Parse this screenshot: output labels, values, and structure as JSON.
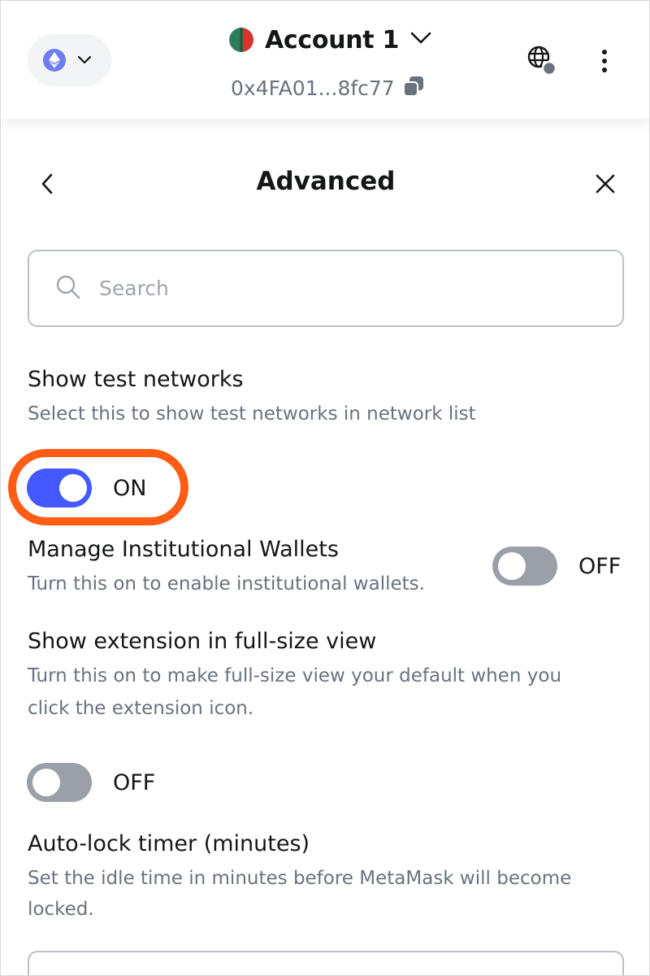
{
  "header": {
    "network_icon": "ethereum-icon",
    "account_name": "Account 1",
    "account_address": "0x4FA01...8fc77",
    "colors": {
      "network_bg": "#f2f4f6",
      "eth": "#6e7bf2"
    }
  },
  "page": {
    "title": "Advanced",
    "back_icon": "chevron-left-icon",
    "close_icon": "close-icon"
  },
  "search": {
    "placeholder": "Search",
    "value": ""
  },
  "settings": [
    {
      "title": "Show test networks",
      "description": "Select this to show test networks in network list",
      "toggle_state": "ON"
    },
    {
      "title": "Manage Institutional Wallets",
      "description": "Turn this on to enable institutional wallets.",
      "toggle_state": "OFF"
    },
    {
      "title": "Show extension in full-size view",
      "description_line1": "Turn this on to make full-size view your default when you",
      "description_line2": "click the extension icon.",
      "toggle_state": "OFF"
    },
    {
      "title": "Auto-lock timer (minutes)",
      "description_line1": "Set the idle time in minutes before MetaMask will become",
      "description_line2": "locked."
    }
  ],
  "colors": {
    "toggle_on": "#4459ff",
    "toggle_off": "#9b9fa8",
    "highlight": "#ff5c16"
  }
}
